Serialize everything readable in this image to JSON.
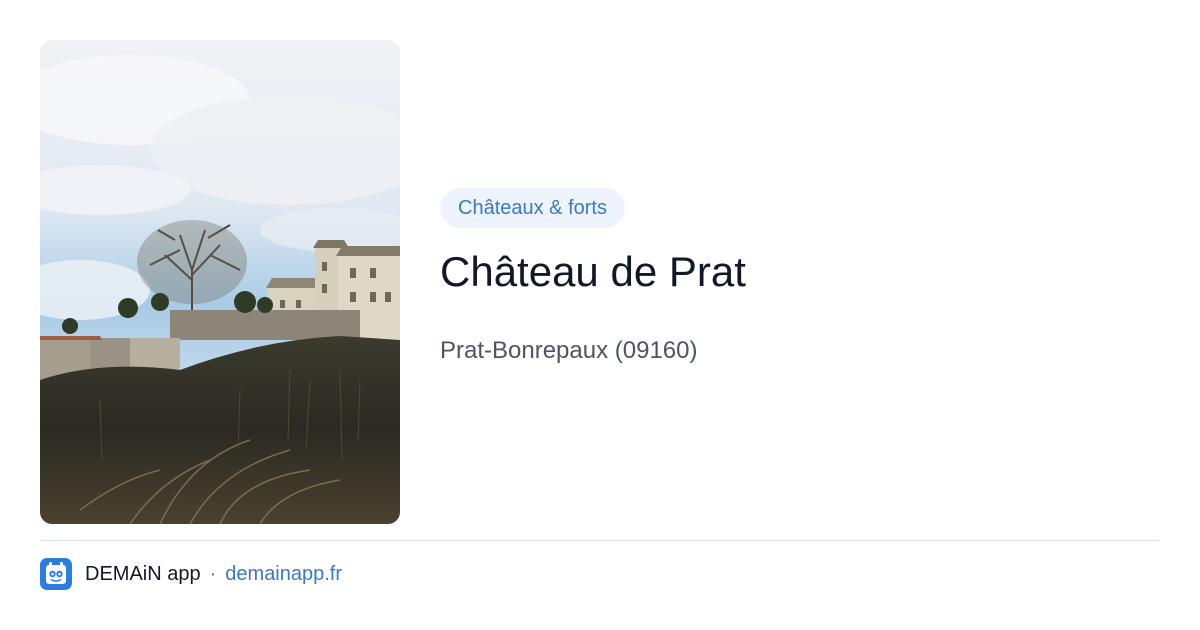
{
  "card": {
    "image_alt": "Château de Prat",
    "category": "Châteaux & forts",
    "title": "Château de Prat",
    "location": "Prat-Bonrepaux (09160)"
  },
  "footer": {
    "app_icon": "demain-app-icon",
    "app_name": "DEMAiN app",
    "separator": "·",
    "url": "demainapp.fr"
  },
  "colors": {
    "accent": "#3a78c9",
    "badge_bg": "#eef4fd",
    "title": "#111827",
    "subtitle": "#4b5563",
    "divider": "#d9e2ea"
  }
}
